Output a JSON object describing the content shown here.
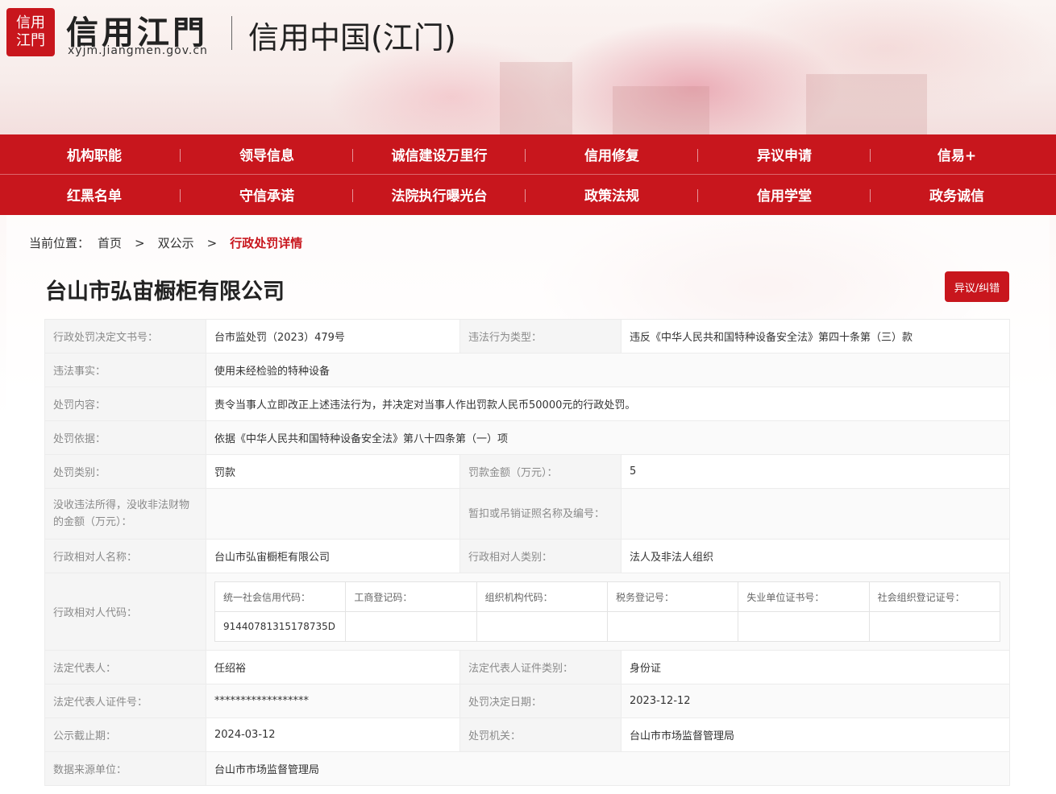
{
  "header": {
    "logo_badge": "信用江門",
    "logo_title": "信用江門",
    "logo_domain": "xyjm.jiangmen.gov.cn",
    "subtitle": "信用中国(江门)"
  },
  "nav": {
    "row1": [
      "机构职能",
      "领导信息",
      "诚信建设万里行",
      "信用修复",
      "异议申请",
      "信易+"
    ],
    "row2": [
      "红黑名单",
      "守信承诺",
      "法院执行曝光台",
      "政策法规",
      "信用学堂",
      "政务诚信"
    ]
  },
  "breadcrumb": {
    "label": "当前位置：",
    "home": "首页",
    "sep": ">",
    "level2": "双公示",
    "current": "行政处罚详情"
  },
  "company_name": "台山市弘宙橱柜有限公司",
  "objection_button": "异议/纠错",
  "detail": {
    "doc_no_label": "行政处罚决定文书号：",
    "doc_no": "台市监处罚（2023）479号",
    "violation_type_label": "违法行为类型：",
    "violation_type": "违反《中华人民共和国特种设备安全法》第四十条第（三）款",
    "facts_label": "违法事实：",
    "facts": "使用未经检验的特种设备",
    "content_label": "处罚内容：",
    "content": "责令当事人立即改正上述违法行为，并决定对当事人作出罚款人民币50000元的行政处罚。",
    "basis_label": "处罚依据：",
    "basis": "依据《中华人民共和国特种设备安全法》第八十四条第（一）项",
    "category_label": "处罚类别：",
    "category": "罚款",
    "amount_label": "罚款金额（万元）：",
    "amount": "5",
    "confiscation_label": "没收违法所得，没收非法财物的金额（万元）：",
    "confiscation": "",
    "license_label": "暂扣或吊销证照名称及编号：",
    "license": "",
    "party_name_label": "行政相对人名称：",
    "party_name": "台山市弘宙橱柜有限公司",
    "party_type_label": "行政相对人类别：",
    "party_type": "法人及非法人组织",
    "party_code_label": "行政相对人代码：",
    "codes": {
      "headers": [
        "统一社会信用代码：",
        "工商登记码：",
        "组织机构代码：",
        "税务登记号：",
        "失业单位证书号：",
        "社会组织登记证号："
      ],
      "values": [
        "91440781315178735D",
        "",
        "",
        "",
        "",
        ""
      ]
    },
    "legal_rep_label": "法定代表人：",
    "legal_rep": "任绍裕",
    "legal_rep_id_type_label": "法定代表人证件类别：",
    "legal_rep_id_type": "身份证",
    "legal_rep_id_label": "法定代表人证件号：",
    "legal_rep_id": "******************",
    "decision_date_label": "处罚决定日期：",
    "decision_date": "2023-12-12",
    "publish_end_label": "公示截止期：",
    "publish_end": "2024-03-12",
    "authority_label": "处罚机关：",
    "authority": "台山市市场监督管理局",
    "source_label": "数据来源单位：",
    "source": "台山市市场监督管理局"
  }
}
